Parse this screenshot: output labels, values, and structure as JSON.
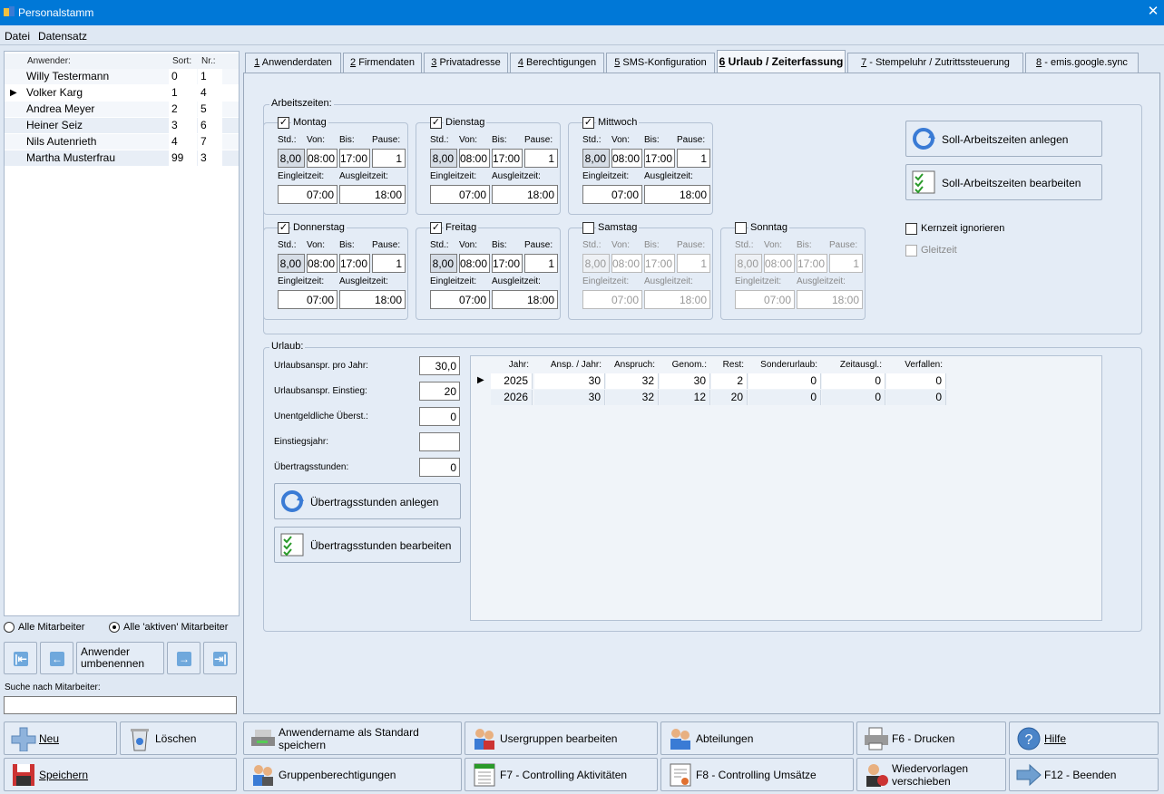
{
  "window": {
    "title": "Personalstamm",
    "close": "✕"
  },
  "menu": [
    "Datei",
    "Datensatz"
  ],
  "userlist": {
    "headers": {
      "name": "Anwender:",
      "sort": "Sort:",
      "nr": "Nr.:"
    },
    "rows": [
      {
        "name": "Willy Testermann",
        "sort": "0",
        "nr": "1"
      },
      {
        "name": "Volker Karg",
        "sort": "1",
        "nr": "4"
      },
      {
        "name": "Andrea Meyer",
        "sort": "2",
        "nr": "5"
      },
      {
        "name": "Heiner Seiz",
        "sort": "3",
        "nr": "6"
      },
      {
        "name": "Nils Autenrieth",
        "sort": "4",
        "nr": "7"
      },
      {
        "name": "Martha Musterfrau",
        "sort": "99",
        "nr": "3"
      }
    ]
  },
  "filter": {
    "all": "Alle Mitarbeiter",
    "active": "Alle 'aktiven' Mitarbeiter"
  },
  "nav": {
    "rename": "Anwender umbenennen"
  },
  "search": {
    "label": "Suche nach Mitarbeiter:",
    "value": ""
  },
  "tabs": [
    {
      "num": "1",
      "label": " Anwenderdaten"
    },
    {
      "num": "2",
      "label": " Firmendaten"
    },
    {
      "num": "3",
      "label": " Privatadresse"
    },
    {
      "num": "4",
      "label": " Berechtigungen"
    },
    {
      "num": "5",
      "label": " SMS-Konfiguration"
    },
    {
      "num": "6",
      "label": " Urlaub / Zeiterfassung"
    },
    {
      "num": "7",
      "label": " - Stempeluhr / Zutrittssteuerung"
    },
    {
      "num": "8",
      "label": " - emis.google.sync"
    }
  ],
  "arbeitszeiten": {
    "title": "Arbeitszeiten:",
    "labels": {
      "std": "Std.:",
      "von": "Von:",
      "bis": "Bis:",
      "pause": "Pause:",
      "ein": "Eingleitzeit:",
      "aus": "Ausgleitzeit:"
    },
    "days": [
      {
        "name": "Montag",
        "checked": "✓",
        "std": "8,00",
        "von": "08:00",
        "bis": "17:00",
        "pause": "1",
        "ein": "07:00",
        "aus": "18:00"
      },
      {
        "name": "Dienstag",
        "checked": "✓",
        "std": "8,00",
        "von": "08:00",
        "bis": "17:00",
        "pause": "1",
        "ein": "07:00",
        "aus": "18:00"
      },
      {
        "name": "Mittwoch",
        "checked": "✓",
        "std": "8,00",
        "von": "08:00",
        "bis": "17:00",
        "pause": "1",
        "ein": "07:00",
        "aus": "18:00"
      },
      {
        "name": "Donnerstag",
        "checked": "✓",
        "std": "8,00",
        "von": "08:00",
        "bis": "17:00",
        "pause": "1",
        "ein": "07:00",
        "aus": "18:00"
      },
      {
        "name": "Freitag",
        "checked": "✓",
        "std": "8,00",
        "von": "08:00",
        "bis": "17:00",
        "pause": "1",
        "ein": "07:00",
        "aus": "18:00"
      },
      {
        "name": "Samstag",
        "checked": "",
        "std": "8,00",
        "von": "08:00",
        "bis": "17:00",
        "pause": "1",
        "ein": "07:00",
        "aus": "18:00"
      },
      {
        "name": "Sonntag",
        "checked": "",
        "std": "8,00",
        "von": "08:00",
        "bis": "17:00",
        "pause": "1",
        "ein": "07:00",
        "aus": "18:00"
      }
    ],
    "soll_anlegen": "Soll-Arbeitszeiten anlegen",
    "soll_bearbeiten": "Soll-Arbeitszeiten bearbeiten",
    "kernzeit": "Kernzeit ignorieren",
    "gleitzeit": "Gleitzeit"
  },
  "urlaub": {
    "title": "Urlaub:",
    "fields": [
      {
        "label": "Urlaubsanspr. pro Jahr:",
        "value": "30,0"
      },
      {
        "label": "Urlaubsanspr. Einstieg:",
        "value": "20"
      },
      {
        "label": "Unentgeldliche Überst.:",
        "value": "0"
      },
      {
        "label": "Einstiegsjahr:",
        "value": ""
      },
      {
        "label": "Übertragsstunden:",
        "value": "0"
      }
    ],
    "btn_anlegen": "Übertragsstunden anlegen",
    "btn_bearbeiten": "Übertragsstunden bearbeiten",
    "grid": {
      "headers": [
        "Jahr:",
        "Ansp. / Jahr:",
        "Anspruch:",
        "Genom.:",
        "Rest:",
        "Sonderurlaub:",
        "Zeitausgl.:",
        "Verfallen:"
      ],
      "rows": [
        [
          "2025",
          "30",
          "32",
          "30",
          "2",
          "0",
          "0",
          "0"
        ],
        [
          "2026",
          "30",
          "32",
          "12",
          "20",
          "0",
          "0",
          "0"
        ]
      ]
    }
  },
  "bottom": {
    "neu": "Neu",
    "loeschen": "Löschen",
    "std_save": "Anwendername als Standard speichern",
    "usergruppen": "Usergruppen bearbeiten",
    "abteilungen": "Abteilungen",
    "drucken": "F6 - Drucken",
    "hilfe": "Hilfe",
    "speichern": "Speichern",
    "gruppenber": "Gruppenberechtigungen",
    "f7": "F7 - Controlling Aktivitäten",
    "f8": "F8 - Controlling Umsätze",
    "wieder": "Wiedervorlagen verschieben",
    "f12": "F12 - Beenden"
  }
}
